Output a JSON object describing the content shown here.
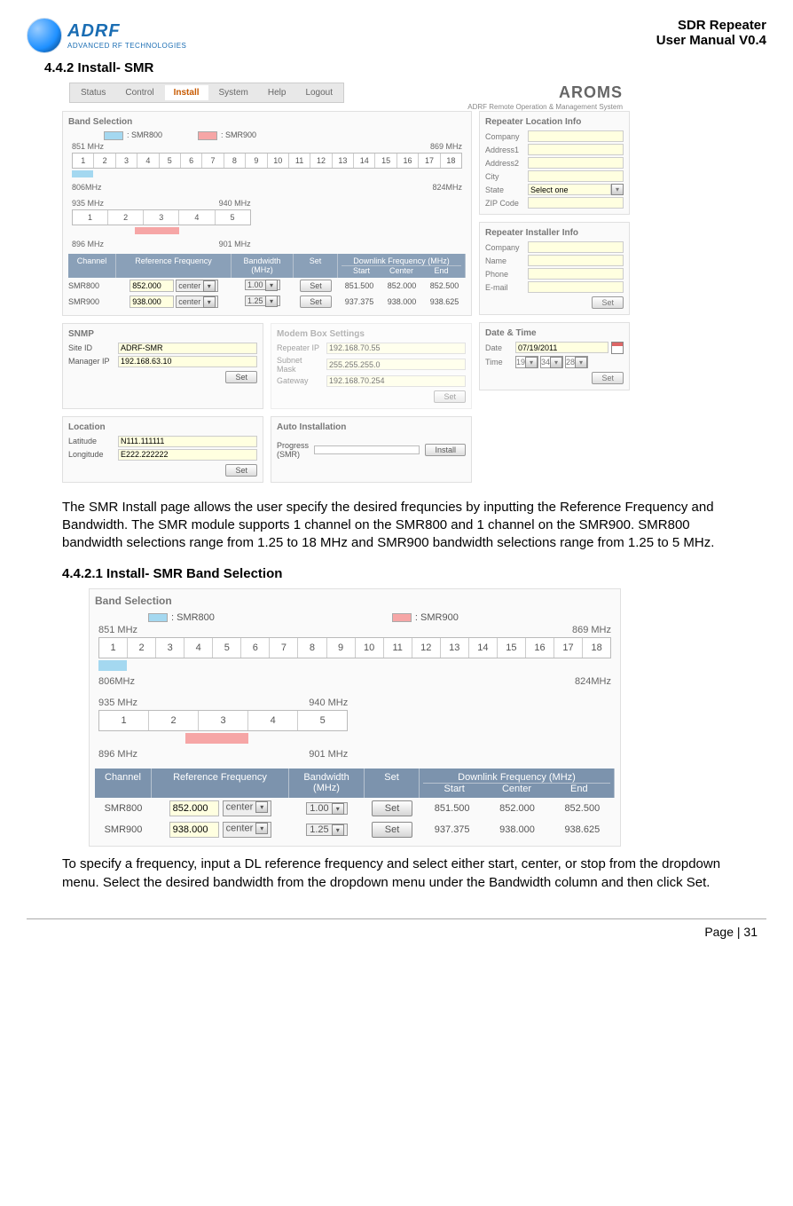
{
  "header": {
    "brand": "ADRF",
    "brand_sub": "ADVANCED RF TECHNOLOGIES",
    "title1": "SDR Repeater",
    "title2": "User Manual V0.4"
  },
  "sec442": "4.4.2 Install- SMR",
  "aroms": "AROMS",
  "aroms_sub": "ADRF Remote Operation & Management System",
  "tabs": [
    "Status",
    "Control",
    "Install",
    "System",
    "Help",
    "Logout"
  ],
  "active_tab": "Install",
  "band_selection_title": "Band Selection",
  "legend": {
    "smr800": ": SMR800",
    "smr900": ": SMR900"
  },
  "row1": {
    "left": "851 MHz",
    "right": "869 MHz",
    "cells": [
      "1",
      "2",
      "3",
      "4",
      "5",
      "6",
      "7",
      "8",
      "9",
      "10",
      "11",
      "12",
      "13",
      "14",
      "15",
      "16",
      "17",
      "18"
    ],
    "bottom_left": "806MHz",
    "bottom_right": "824MHz"
  },
  "row2": {
    "left": "935 MHz",
    "right": "940 MHz",
    "cells": [
      "1",
      "2",
      "3",
      "4",
      "5"
    ],
    "bottom_left": "896 MHz",
    "bottom_right": "901 MHz"
  },
  "ch_head": {
    "channel": "Channel",
    "ref": "Reference Frequency",
    "bw": "Bandwidth\n(MHz)",
    "set": "Set",
    "dl": "Downlink Frequency (MHz)",
    "start": "Start",
    "center": "Center",
    "end": "End"
  },
  "ch_rows": [
    {
      "ch": "SMR800",
      "ref": "852.000",
      "pos": "center",
      "bw": "1.00",
      "start": "851.500",
      "center": "852.000",
      "end": "852.500"
    },
    {
      "ch": "SMR900",
      "ref": "938.000",
      "pos": "center",
      "bw": "1.25",
      "start": "937.375",
      "center": "938.000",
      "end": "938.625"
    }
  ],
  "snmp": {
    "title": "SNMP",
    "site_id_label": "Site ID",
    "site_id": "ADRF-SMR",
    "mgr_label": "Manager IP",
    "mgr": "192.168.63.10",
    "set": "Set"
  },
  "modem": {
    "title": "Modem Box Settings",
    "rip_label": "Repeater IP",
    "rip": "192.168.70.55",
    "sm_label": "Subnet Mask",
    "sm": "255.255.255.0",
    "gw_label": "Gateway",
    "gw": "192.168.70.254",
    "set": "Set"
  },
  "location": {
    "title": "Location",
    "lat_label": "Latitude",
    "lat": "N111.111111",
    "lon_label": "Longitude",
    "lon": "E222.222222",
    "set": "Set"
  },
  "auto": {
    "title": "Auto Installation",
    "progress_label": "Progress\n(SMR)",
    "install": "Install"
  },
  "rli": {
    "title": "Repeater Location Info",
    "company": "Company",
    "addr1": "Address1",
    "addr2": "Address2",
    "city": "City",
    "state": "State",
    "state_val": "Select one",
    "zip": "ZIP Code"
  },
  "rii": {
    "title": "Repeater Installer Info",
    "company": "Company",
    "name": "Name",
    "phone": "Phone",
    "email": "E-mail",
    "set": "Set"
  },
  "dt": {
    "title": "Date & Time",
    "date_label": "Date",
    "date": "07/19/2011",
    "time_label": "Time",
    "h": "19",
    "m": "34",
    "s": "28",
    "set": "Set"
  },
  "para1": "The SMR Install page allows the user specify the desired frequncies by inputting the Reference Frequency and Bandwidth.   The SMR module supports 1 channel on the SMR800 and 1 channel on the SMR900.   SMR800 bandwidth selections range from 1.25 to 18 MHz and SMR900 bandwidth selections range from 1.25 to 5 MHz.",
  "sec4421": "4.4.2.1 Install- SMR Band Selection",
  "para2": "To specify a frequency, input a DL reference frequency and select either start, center, or stop from the dropdown menu.   Select the desired bandwidth from the dropdown menu under the Bandwidth column and then click Set.",
  "footer": "Page | 31",
  "set_label": "Set"
}
